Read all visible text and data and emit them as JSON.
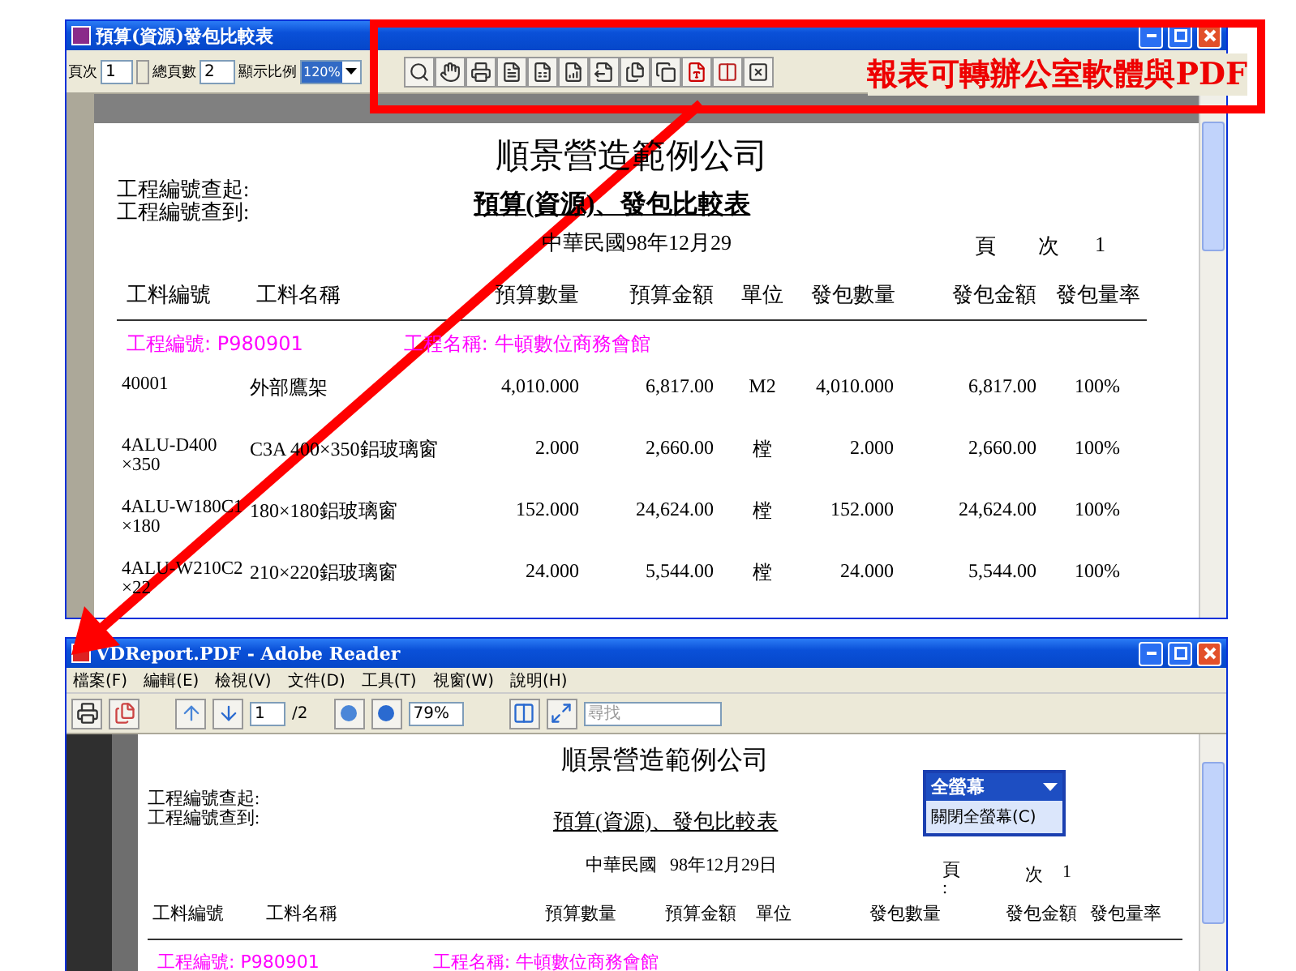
{
  "report_window": {
    "title": "預算(資源)發包比較表",
    "toolbar": {
      "page_label": "頁次",
      "page_value": "1",
      "total_label": "總頁數",
      "total_value": "2",
      "zoom_label": "顯示比例",
      "zoom_value": "120%"
    },
    "report": {
      "company": "順景營造範例公司",
      "range_labels": [
        "工程編號查起:",
        "工程編號查到:"
      ],
      "title": "預算(資源)、發包比較表",
      "date": "中華民國98年12月29",
      "page_label": "頁　　次",
      "page_no": "1",
      "columns": [
        "工料編號",
        "工料名稱",
        "預算數量",
        "預算金額",
        "單位",
        "發包數量",
        "發包金額",
        "發包量率"
      ],
      "group": {
        "code": "工程編號: P980901",
        "name": "工程名稱: 牛頓數位商務會館"
      },
      "rows": [
        {
          "code_lines": [
            "40001"
          ],
          "name": "外部鷹架",
          "budget_qty": "4,010.000",
          "budget_amt": "6,817.00",
          "unit": "M2",
          "sub_qty": "4,010.000",
          "sub_amt": "6,817.00",
          "rate": "100%"
        },
        {
          "code_lines": [
            "4ALU-D400",
            "×350"
          ],
          "name": "C3A 400×350鋁玻璃窗",
          "budget_qty": "2.000",
          "budget_amt": "2,660.00",
          "unit": "樘",
          "sub_qty": "2.000",
          "sub_amt": "2,660.00",
          "rate": "100%"
        },
        {
          "code_lines": [
            "4ALU-W180C1",
            "×180"
          ],
          "name": "180×180鋁玻璃窗",
          "budget_qty": "152.000",
          "budget_amt": "24,624.00",
          "unit": "樘",
          "sub_qty": "152.000",
          "sub_amt": "24,624.00",
          "rate": "100%"
        },
        {
          "code_lines": [
            "4ALU-W210C2",
            "×22"
          ],
          "name": "210×220鋁玻璃窗",
          "budget_qty": "24.000",
          "budget_amt": "5,544.00",
          "unit": "樘",
          "sub_qty": "24.000",
          "sub_amt": "5,544.00",
          "rate": "100%"
        }
      ]
    }
  },
  "callout": {
    "text": "報表可轉辦公室軟體與PDF"
  },
  "pdf_window": {
    "title": "VDReport.PDF - Adobe Reader",
    "menu": [
      "檔案(F)",
      "編輯(E)",
      "檢視(V)",
      "文件(D)",
      "工具(T)",
      "視窗(W)",
      "說明(H)"
    ],
    "toolbar": {
      "page_value": "1",
      "page_total": "/2",
      "zoom_value": "79%",
      "search_placeholder": "尋找"
    },
    "document": {
      "company": "順景營造範例公司",
      "range_labels": [
        "工程編號查起:",
        "工程編號查到:"
      ],
      "title": "預算(資源)、發包比較表",
      "date_era": "中華民國",
      "date": "98年12月29日",
      "page_label": "頁",
      "page_colon": ":",
      "page_label_2": "次",
      "page_no": "1",
      "columns": [
        "工料編號",
        "工料名稱",
        "預算數量",
        "預算金額",
        "單位",
        "發包數量",
        "發包金額",
        "發包量率"
      ],
      "group": {
        "code": "工程編號: P980901",
        "name": "工程名稱: 牛頓數位商務會館"
      }
    },
    "fullscreen_popup": {
      "title": "全螢幕",
      "item": "關閉全螢幕(C)"
    }
  }
}
